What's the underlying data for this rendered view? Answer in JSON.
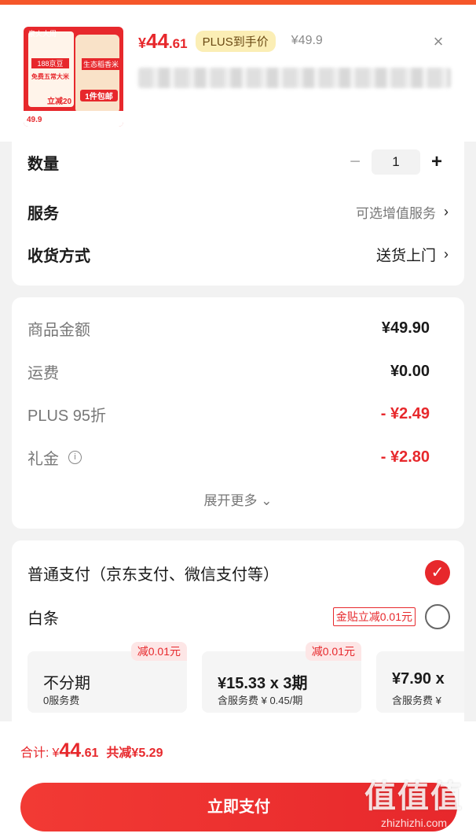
{
  "product": {
    "thumbnail_texts": {
      "brand": "泉火大周",
      "promo_188": "188京豆",
      "free_rice": "免费五常大米",
      "promo_20": "立减20",
      "eco_label": "生态稻香米",
      "package": "1件包邮",
      "thumb_price": "49.9"
    },
    "price_yen": "¥",
    "price_int": "44",
    "price_dec": ".61",
    "plus_tag": "PLUS到手价",
    "original_price": "¥49.9",
    "close_symbol": "×"
  },
  "options": {
    "quantity_label": "数量",
    "quantity_value": "1",
    "minus_symbol": "−",
    "plus_symbol": "+",
    "service_label": "服务",
    "service_hint": "可选增值服务",
    "delivery_label": "收货方式",
    "delivery_value": "送货上门",
    "chevron": "›"
  },
  "fees": {
    "items": [
      {
        "label": "商品金额",
        "value": "¥49.90"
      },
      {
        "label": "运费",
        "value": "¥0.00"
      },
      {
        "label": "PLUS 95折",
        "value": "- ¥2.49"
      },
      {
        "label": "礼金",
        "value": "- ¥2.80"
      }
    ],
    "info_symbol": "i",
    "expand_label": "展开更多 ⌄"
  },
  "payment": {
    "normal_label": "普通支付（京东支付、微信支付等）",
    "check_symbol": "✓",
    "baitiao_label": "白条",
    "subsidy_tag": "金贴立减0.01元",
    "plans": [
      {
        "discount": "减0.01元",
        "title": "不分期",
        "sub": "0服务费"
      },
      {
        "discount": "减0.01元",
        "title": "¥15.33 x 3期",
        "sub": "含服务费 ¥ 0.45/期"
      },
      {
        "discount": "",
        "title": "¥7.90 x",
        "sub": "含服务费 ¥"
      }
    ]
  },
  "footer": {
    "total_label": "合计:",
    "total_yen": "¥",
    "total_int": "44",
    "total_dec": ".61",
    "saved": "共减¥5.29",
    "pay_button": "立即支付"
  },
  "watermark": {
    "big": "值值值",
    "small": "zhizhizhi.com"
  },
  "colors": {
    "accent": "#e7282c",
    "plus_tag_bg": "#fbeeb5",
    "background": "#f2f2f2"
  }
}
